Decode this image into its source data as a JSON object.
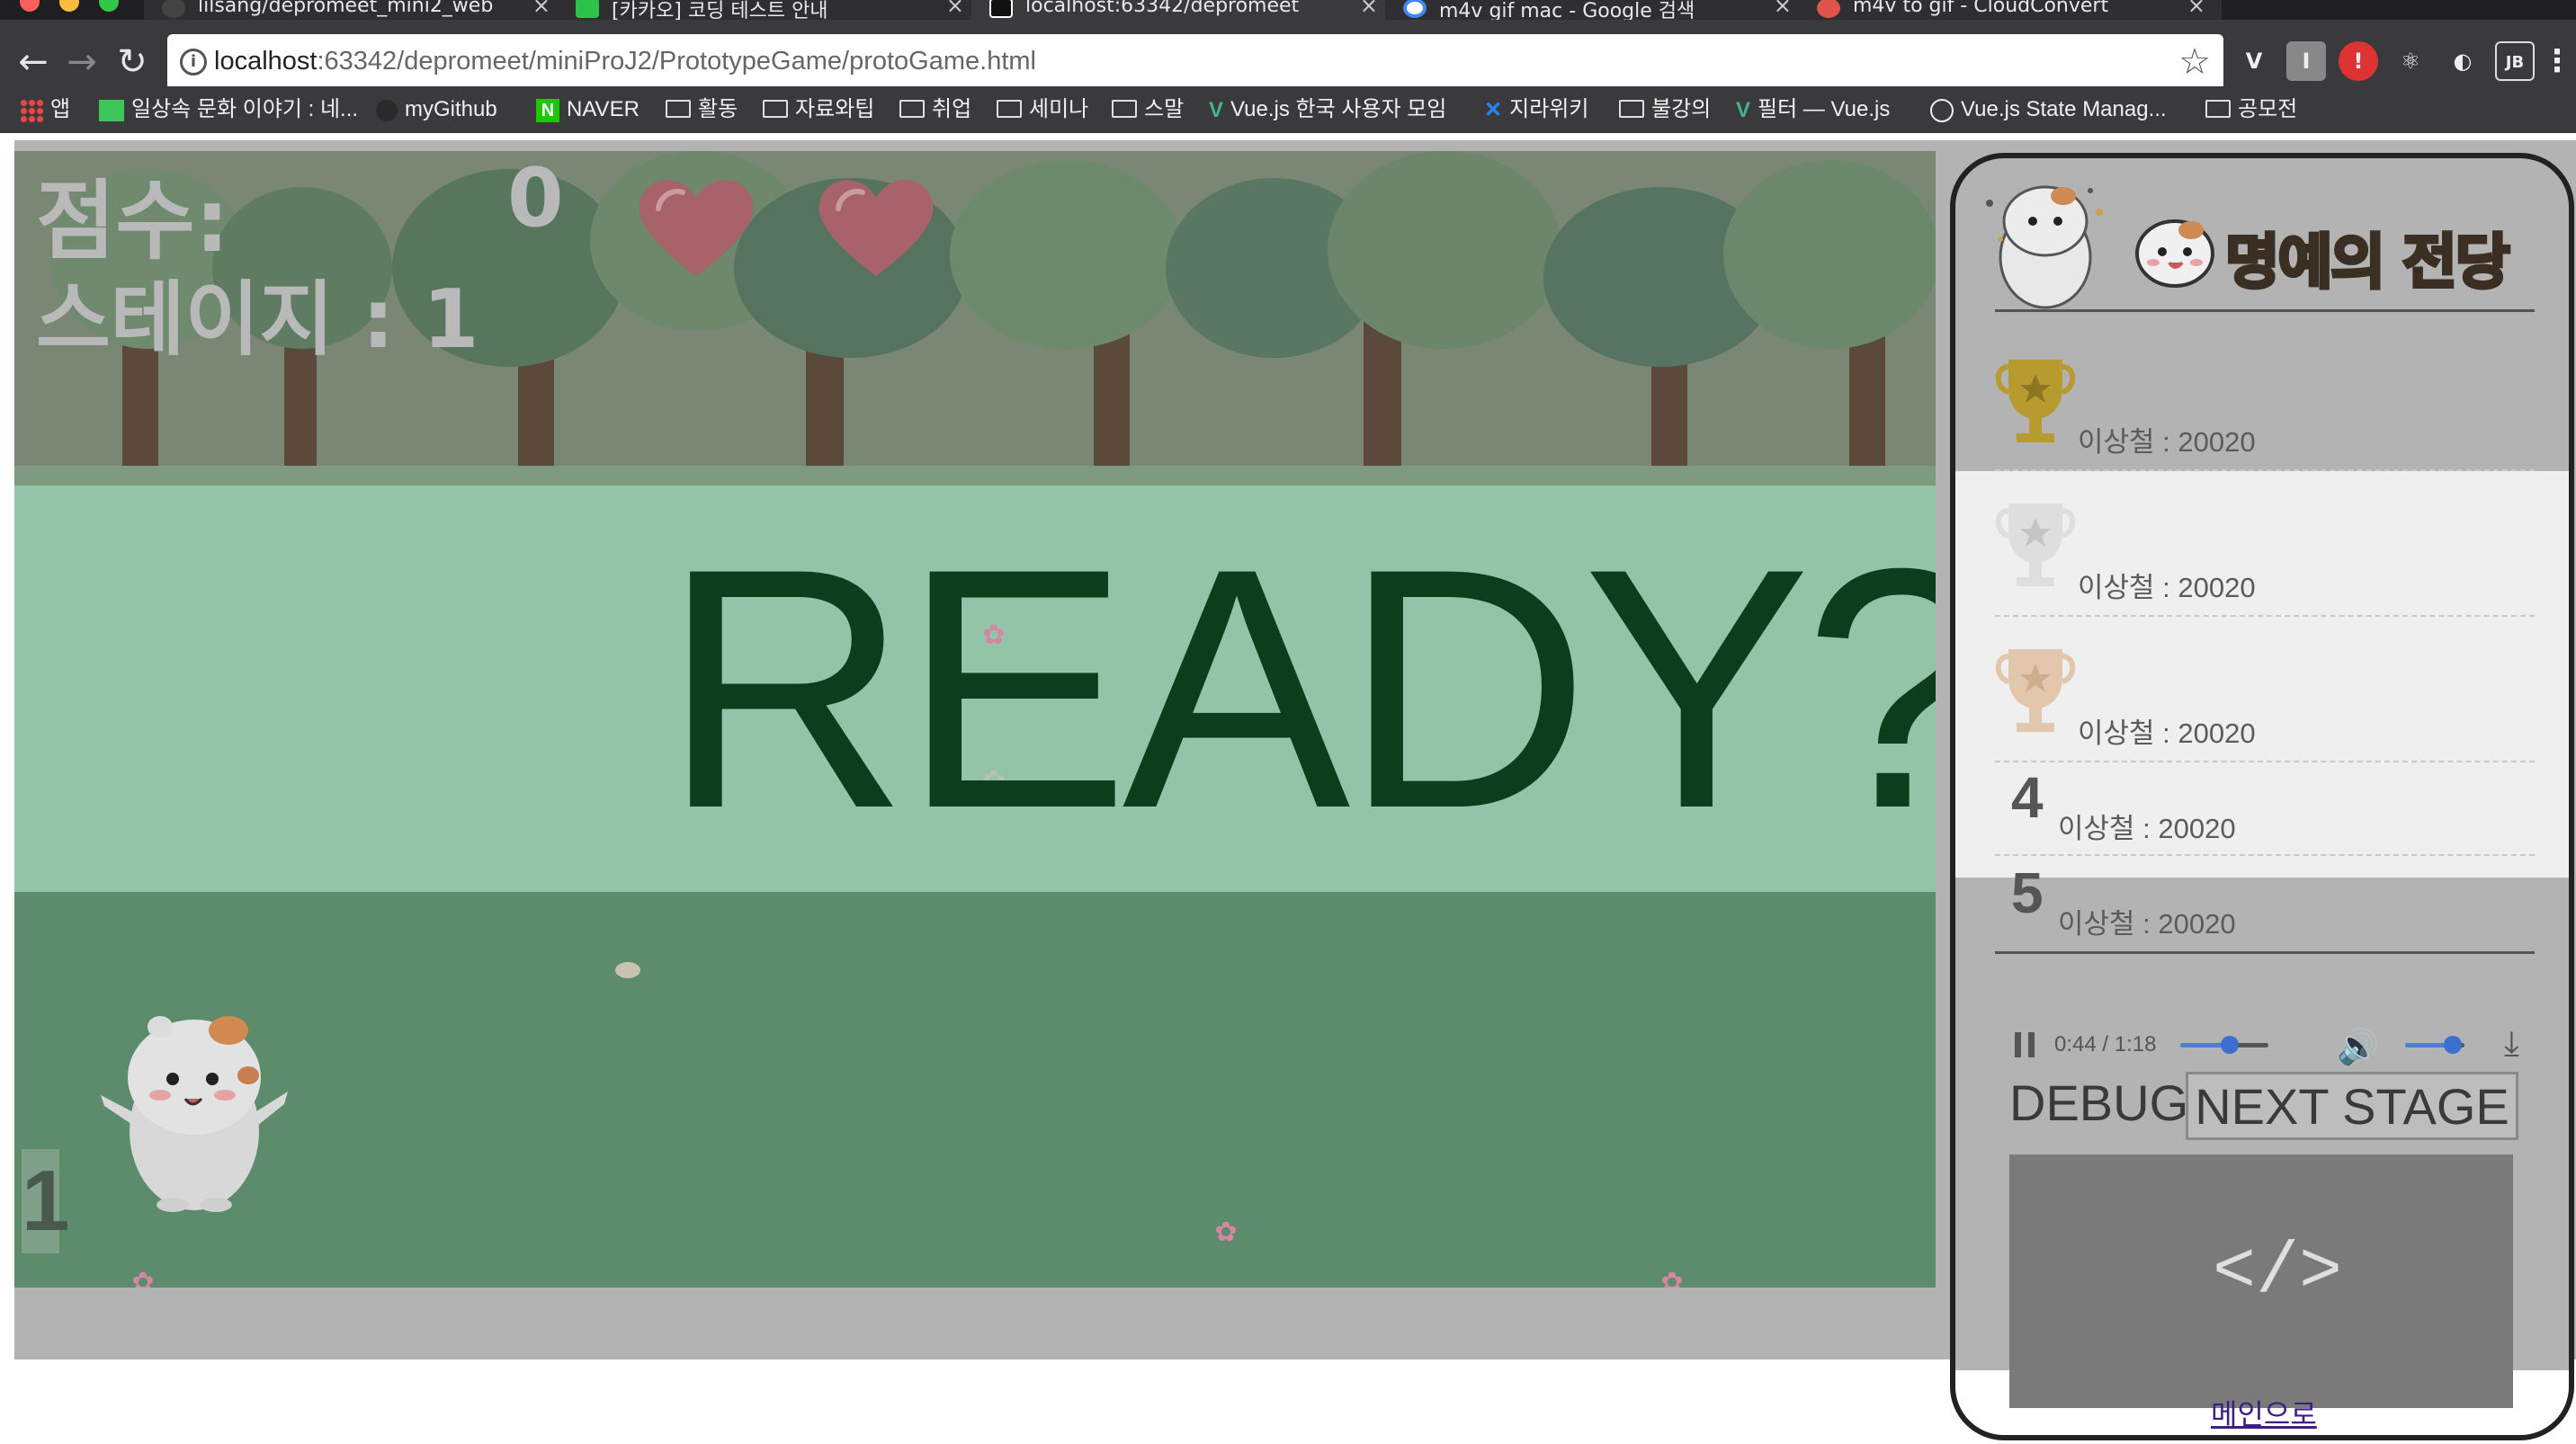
{
  "browser": {
    "tabs": [
      {
        "title": "lilsang/depromeet_mini2_web",
        "active": false
      },
      {
        "title": "[카카오] 코딩 테스트 안내",
        "active": false
      },
      {
        "title": "localhost:63342/depromeet",
        "active": true
      },
      {
        "title": "m4v gif mac - Google 검색",
        "active": false
      },
      {
        "title": "m4v to gif - CloudConvert",
        "active": false
      }
    ],
    "url_host": "localhost",
    "url_path": ":63342/depromeet/miniProJ2/PrototypeGame/protoGame.html",
    "extensions": [
      "V",
      "I",
      "!",
      "⚛",
      "◐",
      "JB"
    ],
    "bookmarks": [
      {
        "label": "앱",
        "icon": "apps-icon"
      },
      {
        "label": "일상속 문화 이야기 : 네...",
        "icon": "naver-blog-icon"
      },
      {
        "label": "myGithub",
        "icon": "github-icon"
      },
      {
        "label": "NAVER",
        "icon": "naver-icon"
      },
      {
        "label": "활동",
        "icon": "folder-icon"
      },
      {
        "label": "자료와팁",
        "icon": "folder-icon"
      },
      {
        "label": "취업",
        "icon": "folder-icon"
      },
      {
        "label": "세미나",
        "icon": "folder-icon"
      },
      {
        "label": "스말",
        "icon": "folder-icon"
      },
      {
        "label": "Vue.js 한국 사용자 모임",
        "icon": "vue-icon"
      },
      {
        "label": "지라위키",
        "icon": "jira-icon"
      },
      {
        "label": "불강의",
        "icon": "folder-icon"
      },
      {
        "label": "필터 — Vue.js",
        "icon": "vue-icon"
      },
      {
        "label": "Vue.js State Manag...",
        "icon": "vue-icon"
      },
      {
        "label": "공모전",
        "icon": "folder-icon"
      }
    ]
  },
  "game": {
    "score_label": "점수:",
    "score_value": "0",
    "stage_label": "스테이지 : 1",
    "lives": 2,
    "ready_text": "READY?",
    "stage_corner": "1"
  },
  "hall_of_fame": {
    "title": "명예의 전당",
    "ranks": [
      {
        "rank": "1",
        "medal": "gold",
        "entry": "이상철 : 20020"
      },
      {
        "rank": "2",
        "medal": "silver",
        "entry": "이상철 : 20020"
      },
      {
        "rank": "3",
        "medal": "bronze",
        "entry": "이상철 : 20020"
      },
      {
        "rank": "4",
        "medal": "none",
        "entry": "이상철 : 20020"
      },
      {
        "rank": "5",
        "medal": "none",
        "entry": "이상철 : 20020"
      }
    ]
  },
  "audio": {
    "time": "0:44 / 1:18",
    "progress": 0.56,
    "volume": 0.8
  },
  "controls": {
    "debug_label": "DEBUG",
    "next_stage_label": "NEXT STAGE",
    "main_link": "메인으로"
  },
  "colors": {
    "ready_text": "#0c3d1d",
    "ready_overlay": "#aadabe",
    "ground": "#5c8c6c",
    "hof_title": "#c9a347",
    "link": "#3b1e86",
    "audio_accent": "#3b6fd0"
  }
}
